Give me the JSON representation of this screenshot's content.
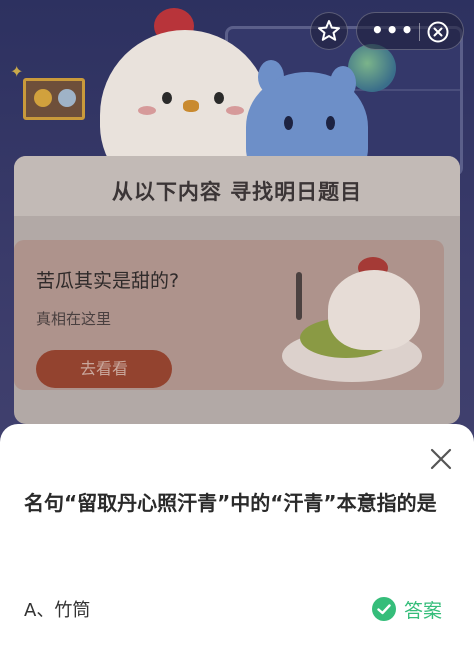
{
  "controls": {
    "star_icon": "star-outline",
    "more_icon": "•••",
    "close_icon": "circle-x"
  },
  "card": {
    "title": "从以下内容 寻找明日题目",
    "promo_title": "苦瓜其实是甜的?",
    "promo_subtitle": "真相在这里",
    "promo_button": "去看看"
  },
  "sheet": {
    "question": "名句“留取丹心照汗青”中的“汗青”本意指的是",
    "option": "A、竹筒",
    "answer_label": "答案",
    "answer_color": "#35bd7a"
  }
}
